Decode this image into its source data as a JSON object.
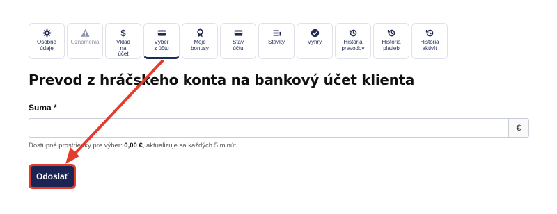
{
  "tabs": [
    {
      "label": "Osobné\núdaje",
      "icon": "gear-icon"
    },
    {
      "label": "Oznámenia",
      "icon": "warning-icon"
    },
    {
      "label": "Vklad\nna\núčet",
      "icon": "dollar-icon"
    },
    {
      "label": "Výber\nz účtu",
      "icon": "card-icon"
    },
    {
      "label": "Moje\nbonusy",
      "icon": "medal-icon"
    },
    {
      "label": "Stav\núčtu",
      "icon": "card-icon"
    },
    {
      "label": "Stávky",
      "icon": "list-icon"
    },
    {
      "label": "Výhry",
      "icon": "check-circle-icon"
    },
    {
      "label": "História\nprevodov",
      "icon": "history-icon"
    },
    {
      "label": "História\nplatieb",
      "icon": "history-icon"
    },
    {
      "label": "História\naktivít",
      "icon": "history-icon"
    }
  ],
  "page": {
    "title": "Prevod z hráčskeho konta na bankový účet klienta"
  },
  "form": {
    "amount_label": "Suma *",
    "amount_value": "",
    "currency": "€",
    "hint_prefix": "Dostupné prostriedky pre výber: ",
    "hint_amount": "0,00 €",
    "hint_suffix": ", aktualizuje sa každých 5 minút",
    "submit_label": "Odoslať"
  },
  "colors": {
    "primary": "#1b2452",
    "annotation": "#e53b2c"
  }
}
